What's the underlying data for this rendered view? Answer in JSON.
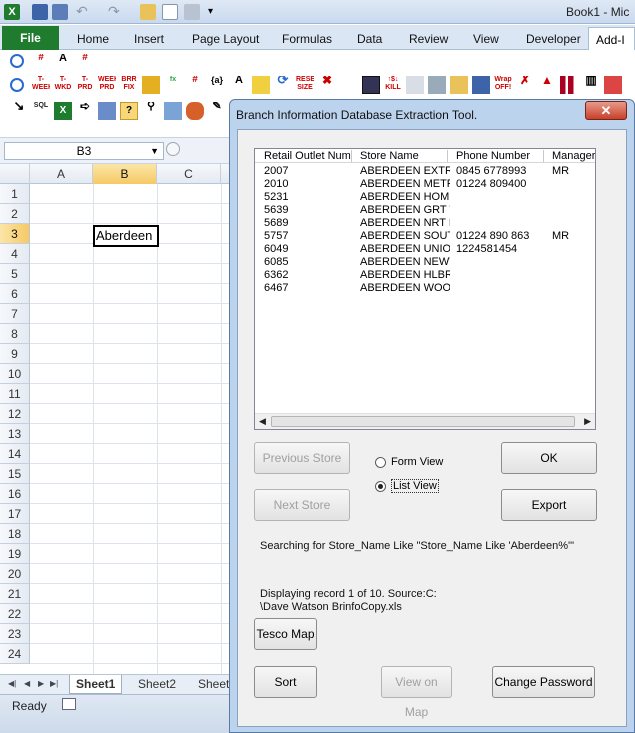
{
  "window": {
    "title": "Book1 - Mic"
  },
  "ribbon": {
    "file_tab": "File",
    "tabs": [
      "Home",
      "Insert",
      "Page Layout",
      "Formulas",
      "Data",
      "Review",
      "View",
      "Developer",
      "Add-I"
    ]
  },
  "formula_bar": {
    "name_box": "B3"
  },
  "grid": {
    "columns": [
      "A",
      "B",
      "C"
    ],
    "rows": [
      "1",
      "2",
      "3",
      "4",
      "5",
      "6",
      "7",
      "8",
      "9",
      "10",
      "11",
      "12",
      "13",
      "14",
      "15",
      "16",
      "17",
      "18",
      "19",
      "20",
      "21",
      "22",
      "23",
      "24"
    ],
    "active_cell_value": "Aberdeen"
  },
  "sheets": [
    "Sheet1",
    "Sheet2",
    "Sheet"
  ],
  "status": {
    "ready": "Ready"
  },
  "dialog": {
    "title": "Branch Information Database Extraction Tool.",
    "close_label": "✕",
    "list": {
      "headers": [
        "Retail  Outlet  Num",
        "Store  Name",
        "Phone  Number",
        "Manager"
      ],
      "rows": [
        [
          "2007",
          "ABERDEEN EXTRA",
          "0845 6778993",
          "MR"
        ],
        [
          "2010",
          "ABERDEEN METRC",
          "01224 809400",
          ""
        ],
        [
          "5231",
          "ABERDEEN HOMEF",
          "",
          ""
        ],
        [
          "5639",
          "ABERDEEN GRT W",
          "",
          ""
        ],
        [
          "5689",
          "ABERDEEN NRT DI",
          "",
          ""
        ],
        [
          "5757",
          "ABERDEEN SOUTH",
          "01224 890 863",
          "MR"
        ],
        [
          "6049",
          "ABERDEEN UNION",
          "1224581454",
          ""
        ],
        [
          "6085",
          "ABERDEEN NEWTC",
          "",
          ""
        ],
        [
          "6362",
          "ABERDEEN HLBRN",
          "",
          ""
        ],
        [
          "6467",
          "ABERDEEN WOOD",
          "",
          ""
        ]
      ]
    },
    "buttons": {
      "previous_store": "Previous Store",
      "next_store": "Next Store",
      "ok": "OK",
      "export": "Export",
      "tesco_map": "Tesco Map",
      "sort": "Sort",
      "view_on_map": "View on Map",
      "change_password": "Change Password"
    },
    "view_options": {
      "form_view": "Form View",
      "list_view": "List View",
      "selected": "List View"
    },
    "search_text": "Searching for Store_Name Like \"Store_Name Like 'Aberdeen%'\"",
    "record_text": "Displaying record 1 of 10.   Source:C:\n\\Dave  Watson  BrinfoCopy.xls"
  }
}
